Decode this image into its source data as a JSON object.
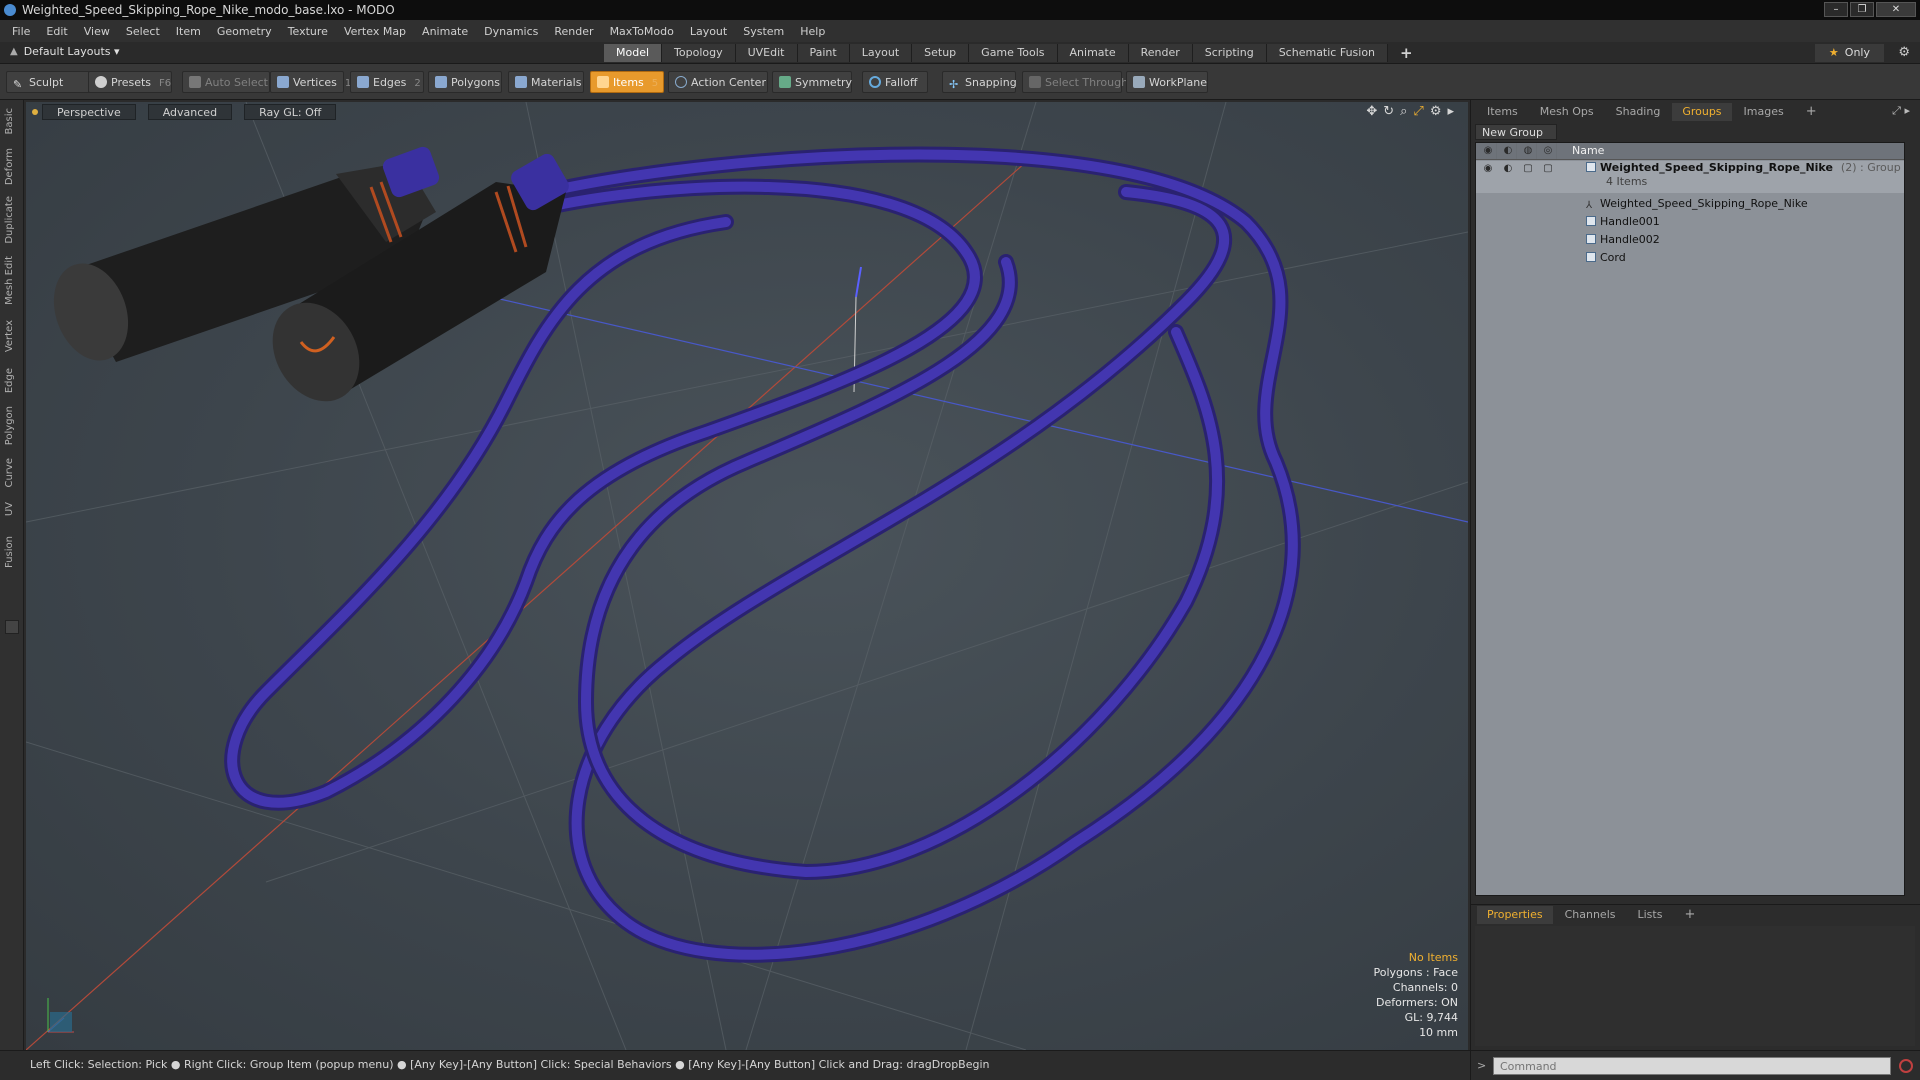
{
  "window": {
    "title": "Weighted_Speed_Skipping_Rope_Nike_modo_base.lxo - MODO",
    "buttons": [
      "–",
      "❐",
      "✕"
    ]
  },
  "menu": [
    "File",
    "Edit",
    "View",
    "Select",
    "Item",
    "Geometry",
    "Texture",
    "Vertex Map",
    "Animate",
    "Dynamics",
    "Render",
    "MaxToModo",
    "Layout",
    "System",
    "Help"
  ],
  "layout": {
    "selector": "Default Layouts ▾",
    "tabs": [
      "Model",
      "Topology",
      "UVEdit",
      "Paint",
      "Layout",
      "Setup",
      "Game Tools",
      "Animate",
      "Render",
      "Scripting",
      "Schematic Fusion"
    ],
    "active_tab": "Model",
    "plus": "+",
    "only": "Only"
  },
  "toolbar": {
    "sculpt": "Sculpt",
    "presets": "Presets",
    "presets_key": "F6",
    "auto_select": "Auto Select",
    "vertices": "Vertices",
    "vertices_count": "1",
    "edges": "Edges",
    "edges_count": "2",
    "polygons": "Polygons",
    "materials": "Materials",
    "items": "Items",
    "items_count": "5",
    "action_center": "Action Center",
    "symmetry": "Symmetry",
    "falloff": "Falloff",
    "snapping": "Snapping",
    "select_through": "Select Through",
    "workplane": "WorkPlane"
  },
  "left_tabs": [
    "Basic",
    "Deform",
    "Duplicate",
    "Mesh Edit",
    "Vertex",
    "Edge",
    "Polygon",
    "Curve",
    "UV",
    "Fusion"
  ],
  "viewport": {
    "perspective": "Perspective",
    "advanced": "Advanced",
    "raygl": "Ray GL: Off",
    "info": {
      "no_items": "No Items",
      "polygons": "Polygons : Face",
      "channels": "Channels: 0",
      "deformers": "Deformers: ON",
      "gl": "GL: 9,744",
      "scale": "10 mm"
    }
  },
  "status": "Left Click: Selection: Pick ● Right Click: Group Item (popup menu) ● [Any Key]-[Any Button] Click: Special Behaviors ● [Any Key]-[Any Button] Click and Drag: dragDropBegin",
  "right_panel": {
    "tabs": [
      "Items",
      "Mesh Ops",
      "Shading",
      "Groups",
      "Images"
    ],
    "active_tab": "Groups",
    "plus": "+",
    "new_group": "New Group",
    "header_name": "Name",
    "group": {
      "name": "Weighted_Speed_Skipping_Rope_Nike",
      "meta": "(2) : Group",
      "count": "4 Items"
    },
    "children": [
      "Weighted_Speed_Skipping_Rope_Nike",
      "Handle001",
      "Handle002",
      "Cord"
    ]
  },
  "props": {
    "tabs": [
      "Properties",
      "Channels",
      "Lists"
    ],
    "active_tab": "Properties",
    "plus": "+"
  },
  "command": {
    "placeholder": "Command",
    "arrow": ">"
  },
  "colors": {
    "accent": "#f0b030",
    "items_active": "#e89a2c",
    "rope": "#3b2f9a"
  }
}
